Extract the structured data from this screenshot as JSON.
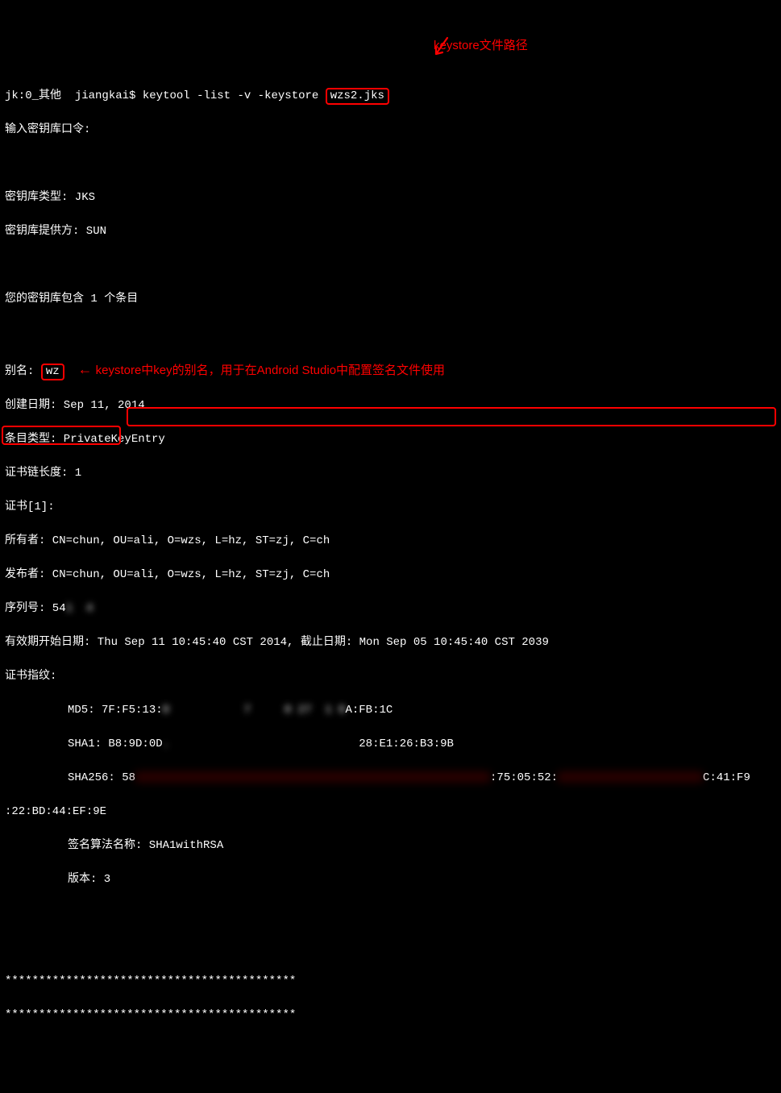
{
  "prompt": {
    "session": "jk:0_其他",
    "user": "jiangkai$",
    "command_pre": "keytool -list -v -keystore ",
    "keystore_file": "wzs2.jks"
  },
  "annotations": {
    "keystore_path": "keystore文件路径",
    "alias_note": "keystore中key的别名，用于在Android Studio中配置签名文件使用",
    "arrow_left": "←"
  },
  "lines": {
    "enter_password": "输入密钥库口令:",
    "keystore_type": "密钥库类型: JKS",
    "keystore_provider": "密钥库提供方: SUN",
    "entry_count": "您的密钥库包含 1 个条目",
    "alias_label": "别名: ",
    "alias_value": "wz",
    "creation_date": "创建日期: Sep 11, 2014",
    "entry_type": "条目类型: PrivateKeyEntry",
    "cert_chain_length": "证书链长度: 1",
    "cert_index": "证书[1]:",
    "owner": "所有者: CN=chun, OU=ali, O=wzs, L=hz, ST=zj, C=ch",
    "issuer": "发布者: CN=chun, OU=ali, O=wzs, L=hz, ST=zj, C=ch",
    "serial_prefix": "序列号: 54",
    "serial_hidden": "1  4",
    "validity": "有效期开始日期: Thu Sep 11 10:45:40 CST 2014, 截止日期: Mon Sep 05 10:45:40 CST 2039",
    "cert_fingerprints": "证书指纹:",
    "md5_prefix": "MD5: 7F:F5:13:",
    "md5_hidden": "0           7     8 27  1 0",
    "md5_suffix": "A:FB:1C",
    "sha1_prefix": "SHA1: B8:9D:0D",
    "sha1_hidden": ".                           ",
    "sha1_suffix": "28:E1:26:B3:9B",
    "sha256_prefix": "SHA256: ",
    "sha256_start": "58",
    "sha256_mid": ":75:05:52:",
    "sha256_end": "C:41:F9",
    "sha256_wrap": ":22:BD:44:EF:9E",
    "sig_algorithm": "签名算法名称: SHA1withRSA",
    "version": "版本: 3",
    "separator": "*******************************************",
    "separator2": "*******************************************"
  }
}
